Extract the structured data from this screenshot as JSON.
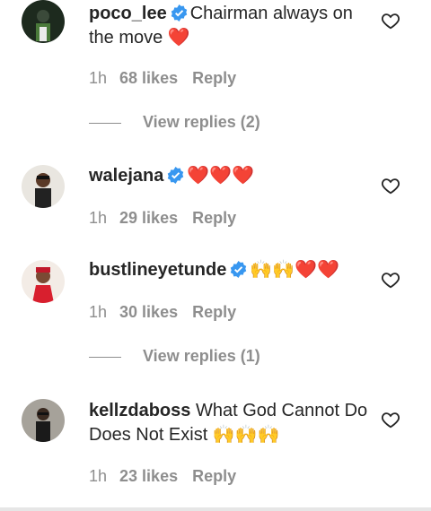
{
  "comments": [
    {
      "username": "poco_lee",
      "verified": true,
      "text": "Chairman always on the move",
      "emoji": "❤️",
      "time": "1h",
      "likes": "68 likes",
      "reply": "Reply",
      "view_replies": "View replies (2)"
    },
    {
      "username": "walejana",
      "verified": true,
      "text": "",
      "emoji": "❤️❤️❤️",
      "time": "1h",
      "likes": "29 likes",
      "reply": "Reply"
    },
    {
      "username": "bustlineyetunde",
      "verified": true,
      "text": "",
      "emoji_claps": "🙌🙌",
      "emoji": "❤️❤️",
      "time": "1h",
      "likes": "30 likes",
      "reply": "Reply",
      "view_replies": "View replies (1)"
    },
    {
      "username": "kellzdaboss",
      "verified": false,
      "text": "What God Cannot Do Does Not Exist",
      "emoji_claps": "🙌🙌🙌",
      "time": "1h",
      "likes": "23 likes",
      "reply": "Reply"
    }
  ],
  "colors": {
    "verified_blue": "#3897f0",
    "meta_gray": "#8e8e8e",
    "heart_red": "#e0162b"
  }
}
